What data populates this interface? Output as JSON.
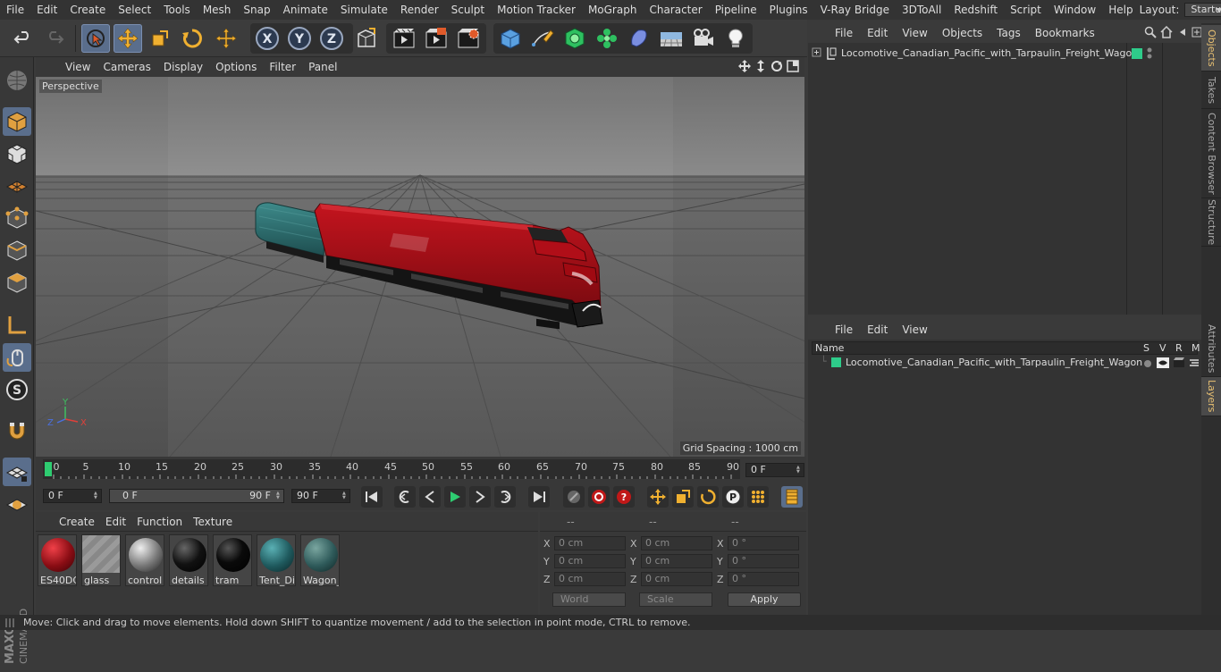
{
  "menubar": {
    "items": [
      "File",
      "Edit",
      "Create",
      "Select",
      "Tools",
      "Mesh",
      "Snap",
      "Animate",
      "Simulate",
      "Render",
      "Sculpt",
      "Motion Tracker",
      "MoGraph",
      "Character",
      "Pipeline",
      "Plugins",
      "V-Ray Bridge",
      "3DToAll",
      "Redshift",
      "Script",
      "Window",
      "Help"
    ],
    "layout_label": "Layout:",
    "layout_value": "Startup"
  },
  "viewport": {
    "menu": [
      "View",
      "Cameras",
      "Display",
      "Options",
      "Filter",
      "Panel"
    ],
    "label": "Perspective",
    "grid_spacing": "Grid Spacing : 1000 cm",
    "axis_labels": {
      "y": "Y",
      "x": "X",
      "z": "Z"
    }
  },
  "timeline": {
    "ticks": [
      "0",
      "5",
      "10",
      "15",
      "20",
      "25",
      "30",
      "35",
      "40",
      "45",
      "50",
      "55",
      "60",
      "65",
      "70",
      "75",
      "80",
      "85",
      "90"
    ],
    "current_frame": "0 F",
    "start": "0 F",
    "range_start": "0 F",
    "range_end": "90 F",
    "end": "90 F"
  },
  "materials": {
    "menu": [
      "Create",
      "Edit",
      "Function",
      "Texture"
    ],
    "items": [
      {
        "name": "ES40DC",
        "color": "#8a0d14"
      },
      {
        "name": "glass",
        "color": "#888888"
      },
      {
        "name": "control",
        "color": "#777777"
      },
      {
        "name": "details",
        "color": "#111111"
      },
      {
        "name": "tram",
        "color": "#0a0a0a"
      },
      {
        "name": "Tent_Di",
        "color": "#1f5a5e"
      },
      {
        "name": "Wagon_",
        "color": "#2e5a5a"
      }
    ]
  },
  "coords": {
    "headers": [
      "--",
      "--",
      "--"
    ],
    "rows": [
      {
        "a": "X",
        "av": "0 cm",
        "b": "X",
        "bv": "0 cm",
        "c": "X",
        "cv": "0 °"
      },
      {
        "a": "Y",
        "av": "0 cm",
        "b": "Y",
        "bv": "0 cm",
        "c": "Y",
        "cv": "0 °"
      },
      {
        "a": "Z",
        "av": "0 cm",
        "b": "Z",
        "bv": "0 cm",
        "c": "Z",
        "cv": "0 °"
      }
    ],
    "world": "World",
    "scale": "Scale",
    "apply": "Apply"
  },
  "objects": {
    "menu": [
      "File",
      "Edit",
      "View",
      "Objects",
      "Tags",
      "Bookmarks"
    ],
    "item": "Locomotive_Canadian_Pacific_with_Tarpaulin_Freight_Wagon"
  },
  "layers": {
    "menu": [
      "File",
      "Edit",
      "View"
    ],
    "cols": {
      "name": "Name",
      "s": "S",
      "v": "V",
      "r": "R",
      "m": "M"
    },
    "item": "Locomotive_Canadian_Pacific_with_Tarpaulin_Freight_Wagon",
    "color": "#2ecc8a"
  },
  "right_tabs": [
    "Objects",
    "Takes",
    "Content Browser",
    "Structure",
    "Attributes",
    "Layers"
  ],
  "status": "Move: Click and drag to move elements. Hold down SHIFT to quantize movement / add to the selection in point mode, CTRL to remove.",
  "brand": {
    "line1": "MAXON",
    "line2": "CINEMA 4D"
  },
  "colors": {
    "accent": "#5a6e8c",
    "layer_green": "#2ecc8a",
    "tab_active": "#e8c072"
  }
}
